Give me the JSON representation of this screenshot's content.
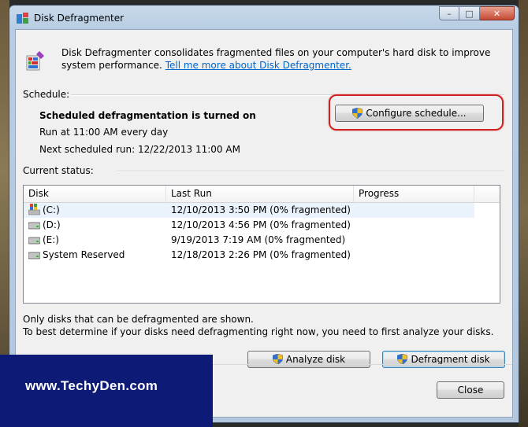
{
  "window": {
    "title": "Disk Defragmenter",
    "controls": {
      "minimize": "–",
      "maximize": "□",
      "close": "✕"
    }
  },
  "intro": {
    "text": "Disk Defragmenter consolidates fragmented files on your computer's hard disk to improve system performance.",
    "link": "Tell me more about Disk Defragmenter."
  },
  "schedule": {
    "label": "Schedule:",
    "status": "Scheduled defragmentation is turned on",
    "run_at": "Run at 11:00 AM every day",
    "next_run": "Next scheduled run: 12/22/2013 11:00 AM",
    "configure_button": "Configure schedule..."
  },
  "current_status": {
    "label": "Current status:",
    "columns": [
      "Disk",
      "Last Run",
      "Progress"
    ],
    "rows": [
      {
        "disk": "(C:)",
        "last_run": "12/10/2013 3:50 PM (0% fragmented)",
        "progress": "",
        "icon": "system-drive-icon"
      },
      {
        "disk": "(D:)",
        "last_run": "12/10/2013 4:56 PM (0% fragmented)",
        "progress": "",
        "icon": "drive-icon"
      },
      {
        "disk": "(E:)",
        "last_run": "9/19/2013 7:19 AM (0% fragmented)",
        "progress": "",
        "icon": "drive-icon"
      },
      {
        "disk": "System Reserved",
        "last_run": "12/18/2013 2:26 PM (0% fragmented)",
        "progress": "",
        "icon": "drive-icon"
      }
    ]
  },
  "notes": {
    "line1": "Only disks that can be defragmented are shown.",
    "line2": "To best determine if your disks need defragmenting right now, you need to first analyze your disks."
  },
  "buttons": {
    "analyze": "Analyze disk",
    "defragment": "Defragment disk",
    "close": "Close"
  },
  "watermark": {
    "text": "www.TechyDen.com"
  },
  "colors": {
    "link": "#0066cc",
    "highlight": "#d02020",
    "banner": "#0d1b77"
  }
}
